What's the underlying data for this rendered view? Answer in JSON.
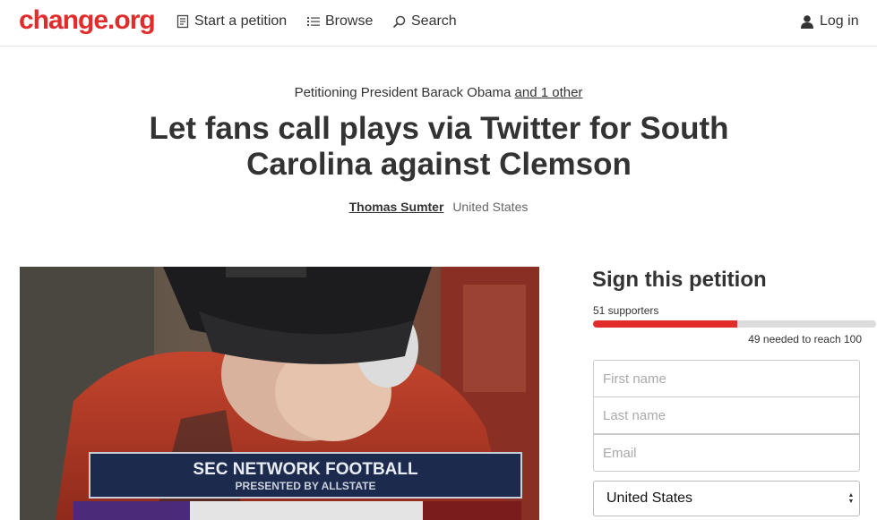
{
  "header": {
    "logo": "change.org",
    "nav": {
      "start": "Start a petition",
      "browse": "Browse",
      "search": "Search",
      "login": "Log in"
    }
  },
  "petition": {
    "petitioning_prefix": "Petitioning President Barack Obama",
    "and_other": "and 1 other",
    "title": "Let fans call plays via Twitter for South Carolina against Clemson",
    "author": "Thomas Sumter",
    "location": "United States"
  },
  "photo": {
    "banner_title": "SEC NETWORK FOOTBALL",
    "banner_subtitle": "PRESENTED BY ALLSTATE"
  },
  "sign": {
    "title": "Sign this petition",
    "supporters": "51 supporters",
    "progress_fraction": 0.51,
    "needed": "49 needed to reach 100",
    "fields": {
      "first_name_placeholder": "First name",
      "last_name_placeholder": "Last name",
      "email_placeholder": "Email"
    },
    "country": "United States"
  },
  "colors": {
    "brand": "#e22b2b",
    "text": "#333333",
    "progress_track": "#dcdcdc"
  },
  "icons": {
    "start": "document-icon",
    "browse": "list-icon",
    "search": "search-icon",
    "login": "user-icon"
  }
}
